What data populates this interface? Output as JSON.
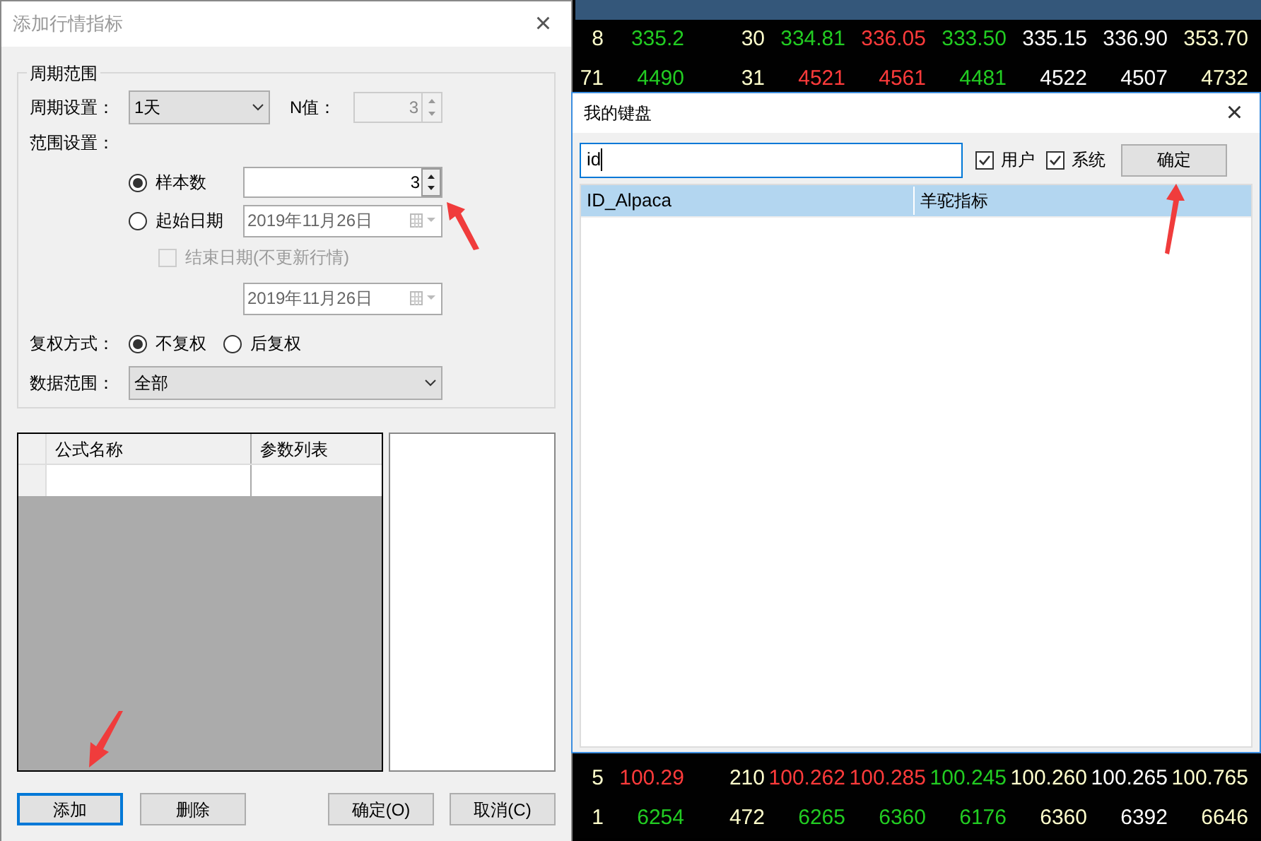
{
  "background_table": {
    "rows": [
      {
        "selected": true
      },
      {
        "selected": false,
        "cells": [
          {
            "text": "8",
            "color": "#ffffcc"
          },
          {
            "text": "335.2",
            "color": "#22cc22"
          },
          {
            "text": "30",
            "color": "#ffffcc"
          },
          {
            "text": "334.81",
            "color": "#22cc22"
          },
          {
            "text": "336.05",
            "color": "#ff3b3b"
          },
          {
            "text": "333.50",
            "color": "#22cc22"
          },
          {
            "text": "335.15",
            "color": "#ffffff"
          },
          {
            "text": "336.90",
            "color": "#ffffff"
          },
          {
            "text": "353.70",
            "color": "#ffffcc"
          }
        ]
      },
      {
        "selected": false,
        "cells": [
          {
            "text": "71",
            "color": "#ffffcc"
          },
          {
            "text": "4490",
            "color": "#22cc22"
          },
          {
            "text": "31",
            "color": "#ffffcc"
          },
          {
            "text": "4521",
            "color": "#ff3b3b"
          },
          {
            "text": "4561",
            "color": "#ff3b3b"
          },
          {
            "text": "4481",
            "color": "#22cc22"
          },
          {
            "text": "4522",
            "color": "#ffffff"
          },
          {
            "text": "4507",
            "color": "#ffffff"
          },
          {
            "text": "4732",
            "color": "#ffffcc"
          }
        ]
      },
      {
        "selected": false,
        "cells": [
          {
            "text": "5",
            "color": "#ffffcc"
          },
          {
            "text": "100.29",
            "color": "#ff3b3b"
          },
          {
            "text": "210",
            "color": "#ffffcc"
          },
          {
            "text": "100.262",
            "color": "#ff3b3b"
          },
          {
            "text": "100.285",
            "color": "#ff3b3b"
          },
          {
            "text": "100.245",
            "color": "#22cc22"
          },
          {
            "text": "100.260",
            "color": "#ffffcc"
          },
          {
            "text": "100.265",
            "color": "#ffffff"
          },
          {
            "text": "100.765",
            "color": "#ffffcc"
          }
        ]
      },
      {
        "selected": false,
        "cells": [
          {
            "text": "1",
            "color": "#ffffcc"
          },
          {
            "text": "6254",
            "color": "#22cc22"
          },
          {
            "text": "472",
            "color": "#ffffcc"
          },
          {
            "text": "6265",
            "color": "#22cc22"
          },
          {
            "text": "6360",
            "color": "#22cc22"
          },
          {
            "text": "6176",
            "color": "#22cc22"
          },
          {
            "text": "6360",
            "color": "#ffffcc"
          },
          {
            "text": "6392",
            "color": "#ffffff"
          },
          {
            "text": "6646",
            "color": "#ffffcc"
          }
        ]
      }
    ]
  },
  "add_dialog": {
    "title": "添加行情指标",
    "close": "×",
    "group_title": "周期范围",
    "period_label": "周期设置：",
    "period_value": "1天",
    "n_label": "N值：",
    "n_value": "3",
    "n_disabled": true,
    "range_label": "范围设置：",
    "range_options": [
      {
        "label": "样本数",
        "selected": true
      },
      {
        "label": "起始日期",
        "selected": false
      }
    ],
    "sample_count": "3",
    "start_date": "2019年11月26日",
    "end_date_check": {
      "label": "结束日期(不更新行情)",
      "checked": false,
      "disabled": true
    },
    "end_date": "2019年11月26日",
    "adjust_label": "复权方式：",
    "adjust_options": [
      {
        "label": "不复权",
        "selected": true
      },
      {
        "label": "后复权",
        "selected": false
      }
    ],
    "data_range_label": "数据范围：",
    "data_range_value": "全部",
    "table": {
      "columns": [
        "公式名称",
        "参数列表"
      ]
    },
    "buttons": [
      {
        "label": "添加",
        "focused": true
      },
      {
        "label": "删除",
        "focused": false
      },
      {
        "label": "确定(O)",
        "focused": false
      },
      {
        "label": "取消(C)",
        "focused": false
      }
    ]
  },
  "keyboard_dialog": {
    "title": "我的键盘",
    "close": "×",
    "search_value": "id",
    "filters": [
      {
        "label": "用户",
        "checked": true
      },
      {
        "label": "系统",
        "checked": true
      }
    ],
    "ok_button": "确定",
    "rows": [
      {
        "code": "ID_Alpaca",
        "name": "羊驼指标",
        "selected": true
      }
    ]
  }
}
